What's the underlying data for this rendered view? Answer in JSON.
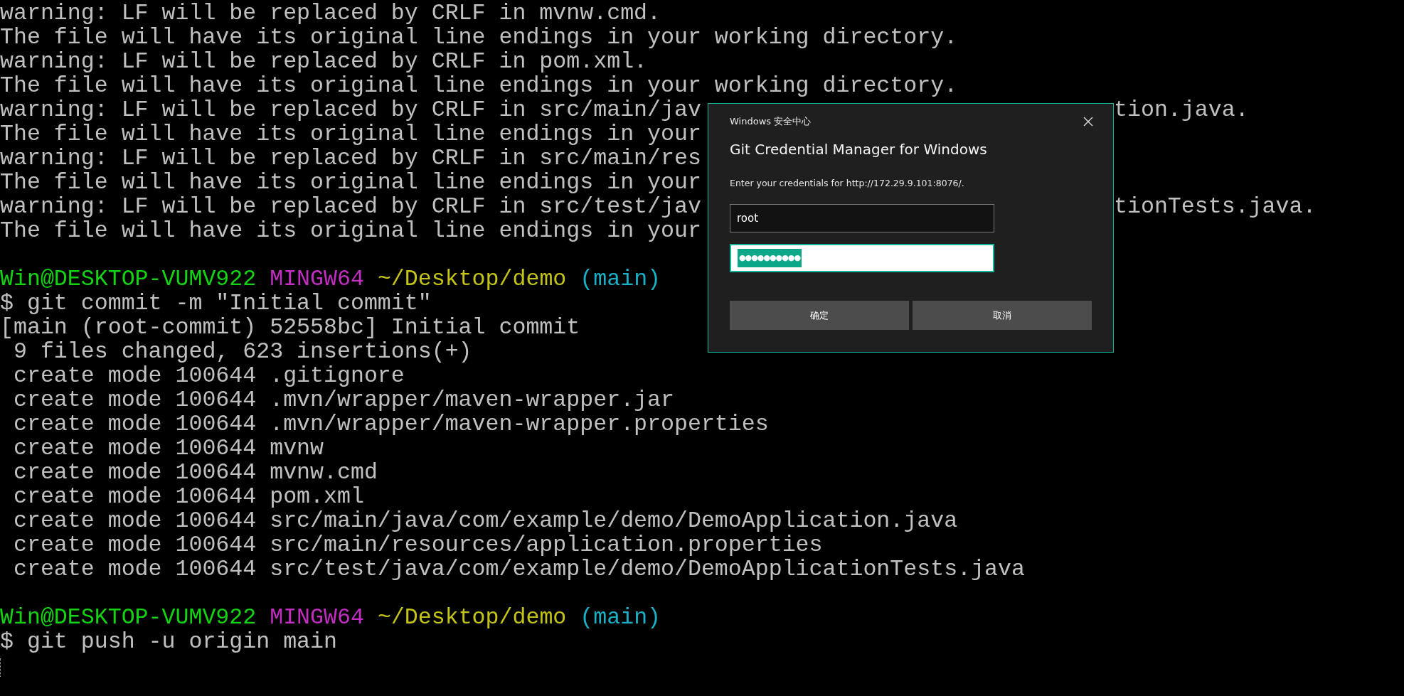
{
  "terminal": {
    "lines": [
      {
        "kind": "text",
        "text": "warning: LF will be replaced by CRLF in mvnw.cmd."
      },
      {
        "kind": "text",
        "text": "The file will have its original line endings in your working directory."
      },
      {
        "kind": "text",
        "text": "warning: LF will be replaced by CRLF in pom.xml."
      },
      {
        "kind": "text",
        "text": "The file will have its original line endings in your working directory."
      },
      {
        "kind": "text",
        "text": "warning: LF will be replaced by CRLF in src/main/jav",
        "tail": "tion.java."
      },
      {
        "kind": "text",
        "text": "The file will have its original line endings in your"
      },
      {
        "kind": "text",
        "text": "warning: LF will be replaced by CRLF in src/main/res"
      },
      {
        "kind": "text",
        "text": "The file will have its original line endings in your"
      },
      {
        "kind": "text",
        "text": "warning: LF will be replaced by CRLF in src/test/jav",
        "tail": "tionTests.java."
      },
      {
        "kind": "text",
        "text": "The file will have its original line endings in your"
      },
      {
        "kind": "blank"
      },
      {
        "kind": "prompt",
        "segments": [
          {
            "text": "Win@DESKTOP-VUMV922",
            "color": "#13d413"
          },
          {
            "text": "MINGW64",
            "color": "#c22dc2"
          },
          {
            "text": "~/Desktop/demo",
            "color": "#c4c418"
          },
          {
            "text": "(main)",
            "color": "#1ab0c8"
          }
        ]
      },
      {
        "kind": "text",
        "text": "$ git commit -m \"Initial commit\""
      },
      {
        "kind": "text",
        "text": "[main (root-commit) 52558bc] Initial commit"
      },
      {
        "kind": "text",
        "text": " 9 files changed, 623 insertions(+)"
      },
      {
        "kind": "text",
        "text": " create mode 100644 .gitignore"
      },
      {
        "kind": "text",
        "text": " create mode 100644 .mvn/wrapper/maven-wrapper.jar"
      },
      {
        "kind": "text",
        "text": " create mode 100644 .mvn/wrapper/maven-wrapper.properties"
      },
      {
        "kind": "text",
        "text": " create mode 100644 mvnw"
      },
      {
        "kind": "text",
        "text": " create mode 100644 mvnw.cmd"
      },
      {
        "kind": "text",
        "text": " create mode 100644 pom.xml"
      },
      {
        "kind": "text",
        "text": " create mode 100644 src/main/java/com/example/demo/DemoApplication.java"
      },
      {
        "kind": "text",
        "text": " create mode 100644 src/main/resources/application.properties"
      },
      {
        "kind": "text",
        "text": " create mode 100644 src/test/java/com/example/demo/DemoApplicationTests.java"
      },
      {
        "kind": "blank"
      },
      {
        "kind": "prompt",
        "segments": [
          {
            "text": "Win@DESKTOP-VUMV922",
            "color": "#13d413"
          },
          {
            "text": "MINGW64",
            "color": "#c22dc2"
          },
          {
            "text": "~/Desktop/demo",
            "color": "#c4c418"
          },
          {
            "text": "(main)",
            "color": "#1ab0c8"
          }
        ]
      },
      {
        "kind": "text",
        "text": "$ git push -u origin main"
      },
      {
        "kind": "cursor"
      }
    ]
  },
  "dialog": {
    "window_title": "Windows 安全中心",
    "heading": "Git Credential Manager for Windows",
    "message": "Enter your credentials for http://172.29.9.101:8076/.",
    "username": {
      "value": "root",
      "focused": false
    },
    "password": {
      "value": "●●●●●●●●●●",
      "focused": true,
      "text_selected": true
    },
    "buttons": [
      "确定",
      "取消"
    ]
  }
}
